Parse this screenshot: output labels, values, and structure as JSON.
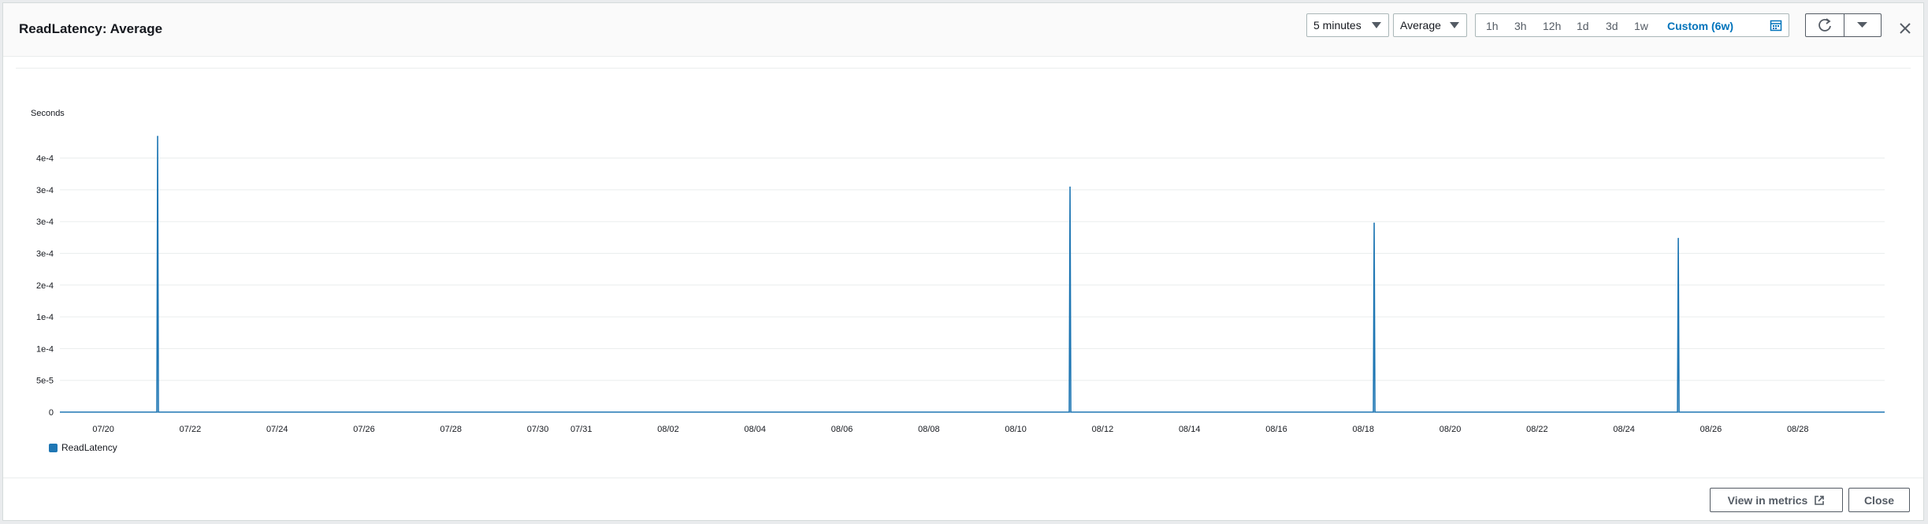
{
  "modal": {
    "title": "ReadLatency: Average",
    "period_select": "5 minutes",
    "stat_select": "Average",
    "time_ranges": [
      "1h",
      "3h",
      "12h",
      "1d",
      "3d",
      "1w",
      "Custom (6w)"
    ],
    "active_time_range": "Custom (6w)",
    "footer": {
      "view_metrics_label": "View in metrics",
      "close_label": "Close"
    }
  },
  "colors": {
    "series": "#1f77b4",
    "accent": "#0073bb"
  },
  "icons": [
    "calendar-icon",
    "refresh-icon",
    "caret-down-icon",
    "close-icon",
    "external-link-icon"
  ],
  "chart_data": {
    "type": "line",
    "ylabel": "Seconds",
    "y_ticks": [
      "0",
      "5e-5",
      "1e-4",
      "1e-4",
      "2e-4",
      "3e-4",
      "3e-4",
      "3e-4",
      "4e-4"
    ],
    "ylim": [
      0,
      0.000435
    ],
    "x_ticks": [
      "07/20",
      "07/22",
      "07/24",
      "07/26",
      "07/28",
      "07/30",
      "07/31",
      "08/02",
      "08/04",
      "08/06",
      "08/08",
      "08/10",
      "08/12",
      "08/14",
      "08/16",
      "08/18",
      "08/20",
      "08/22",
      "08/24",
      "08/26",
      "08/28"
    ],
    "xlim": [
      "2023-07-19",
      "2023-08-30"
    ],
    "grid": true,
    "legend_position": "bottom-left",
    "series": [
      {
        "name": "ReadLatency",
        "points": [
          {
            "x": "2023-07-21 06:00",
            "y": 0.000435
          },
          {
            "x": "2023-08-11 06:00",
            "y": 0.000355
          },
          {
            "x": "2023-08-18 06:00",
            "y": 0.000298
          },
          {
            "x": "2023-08-25 06:00",
            "y": 0.000274
          }
        ],
        "baseline": 0
      }
    ]
  }
}
